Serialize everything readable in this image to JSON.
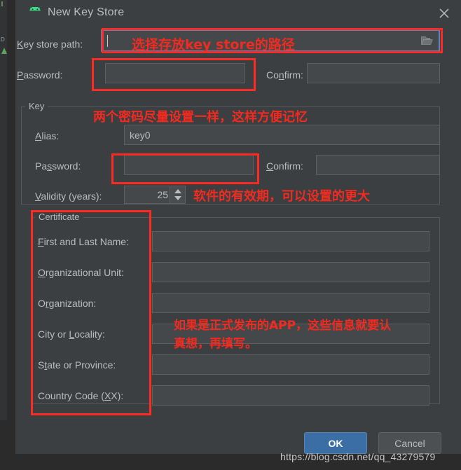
{
  "window": {
    "title": "New Key Store",
    "icon": "android-robot-icon",
    "close_label": "✕",
    "bg_color": "#3c3f41",
    "accent_color": "#3b6ea5",
    "annotation_color": "#f22a1f"
  },
  "keystore": {
    "path_label": "Key store path:",
    "path_label_mnemonic": "K",
    "path_value": "",
    "browse_icon": "folder-open-icon",
    "password_label": "Password:",
    "password_label_mnemonic": "P",
    "password_value": "",
    "confirm_label": "Confirm:",
    "confirm_label_mnemonic": "n",
    "confirm_value": ""
  },
  "key_group": {
    "title": "Key",
    "alias_label": "Alias:",
    "alias_label_mnemonic": "A",
    "alias_value": "key0",
    "password_label": "Password:",
    "password_label_mnemonic": "s",
    "password_value": "",
    "confirm_label": "Confirm:",
    "confirm_label_mnemonic": "C",
    "confirm_value": "",
    "validity_label": "Validity (years):",
    "validity_label_mnemonic": "V",
    "validity_value": "25"
  },
  "certificate_group": {
    "title": "Certificate",
    "fields": [
      {
        "label": "First and Last Name:",
        "mnemonic": "F",
        "value": ""
      },
      {
        "label": "Organizational Unit:",
        "mnemonic": "O",
        "value": ""
      },
      {
        "label": "Organization:",
        "mnemonic": "r",
        "value": ""
      },
      {
        "label": "City or Locality:",
        "mnemonic": "L",
        "value": ""
      },
      {
        "label": "State or Province:",
        "mnemonic": "t",
        "value": ""
      },
      {
        "label": "Country Code (XX):",
        "mnemonic": "X",
        "value": ""
      }
    ]
  },
  "buttons": {
    "ok": "OK",
    "cancel": "Cancel"
  },
  "annotations": {
    "path": "选择存放key store的路径",
    "passwords": "两个密码尽量设置一样，这样方便记忆",
    "validity": "软件的有效期，可以设置的更大",
    "certificate": "如果是正式发布的APP，这些信息就要认\n真想，再填写。"
  },
  "watermark": "https://blog.csdn.net/qq_43279579"
}
